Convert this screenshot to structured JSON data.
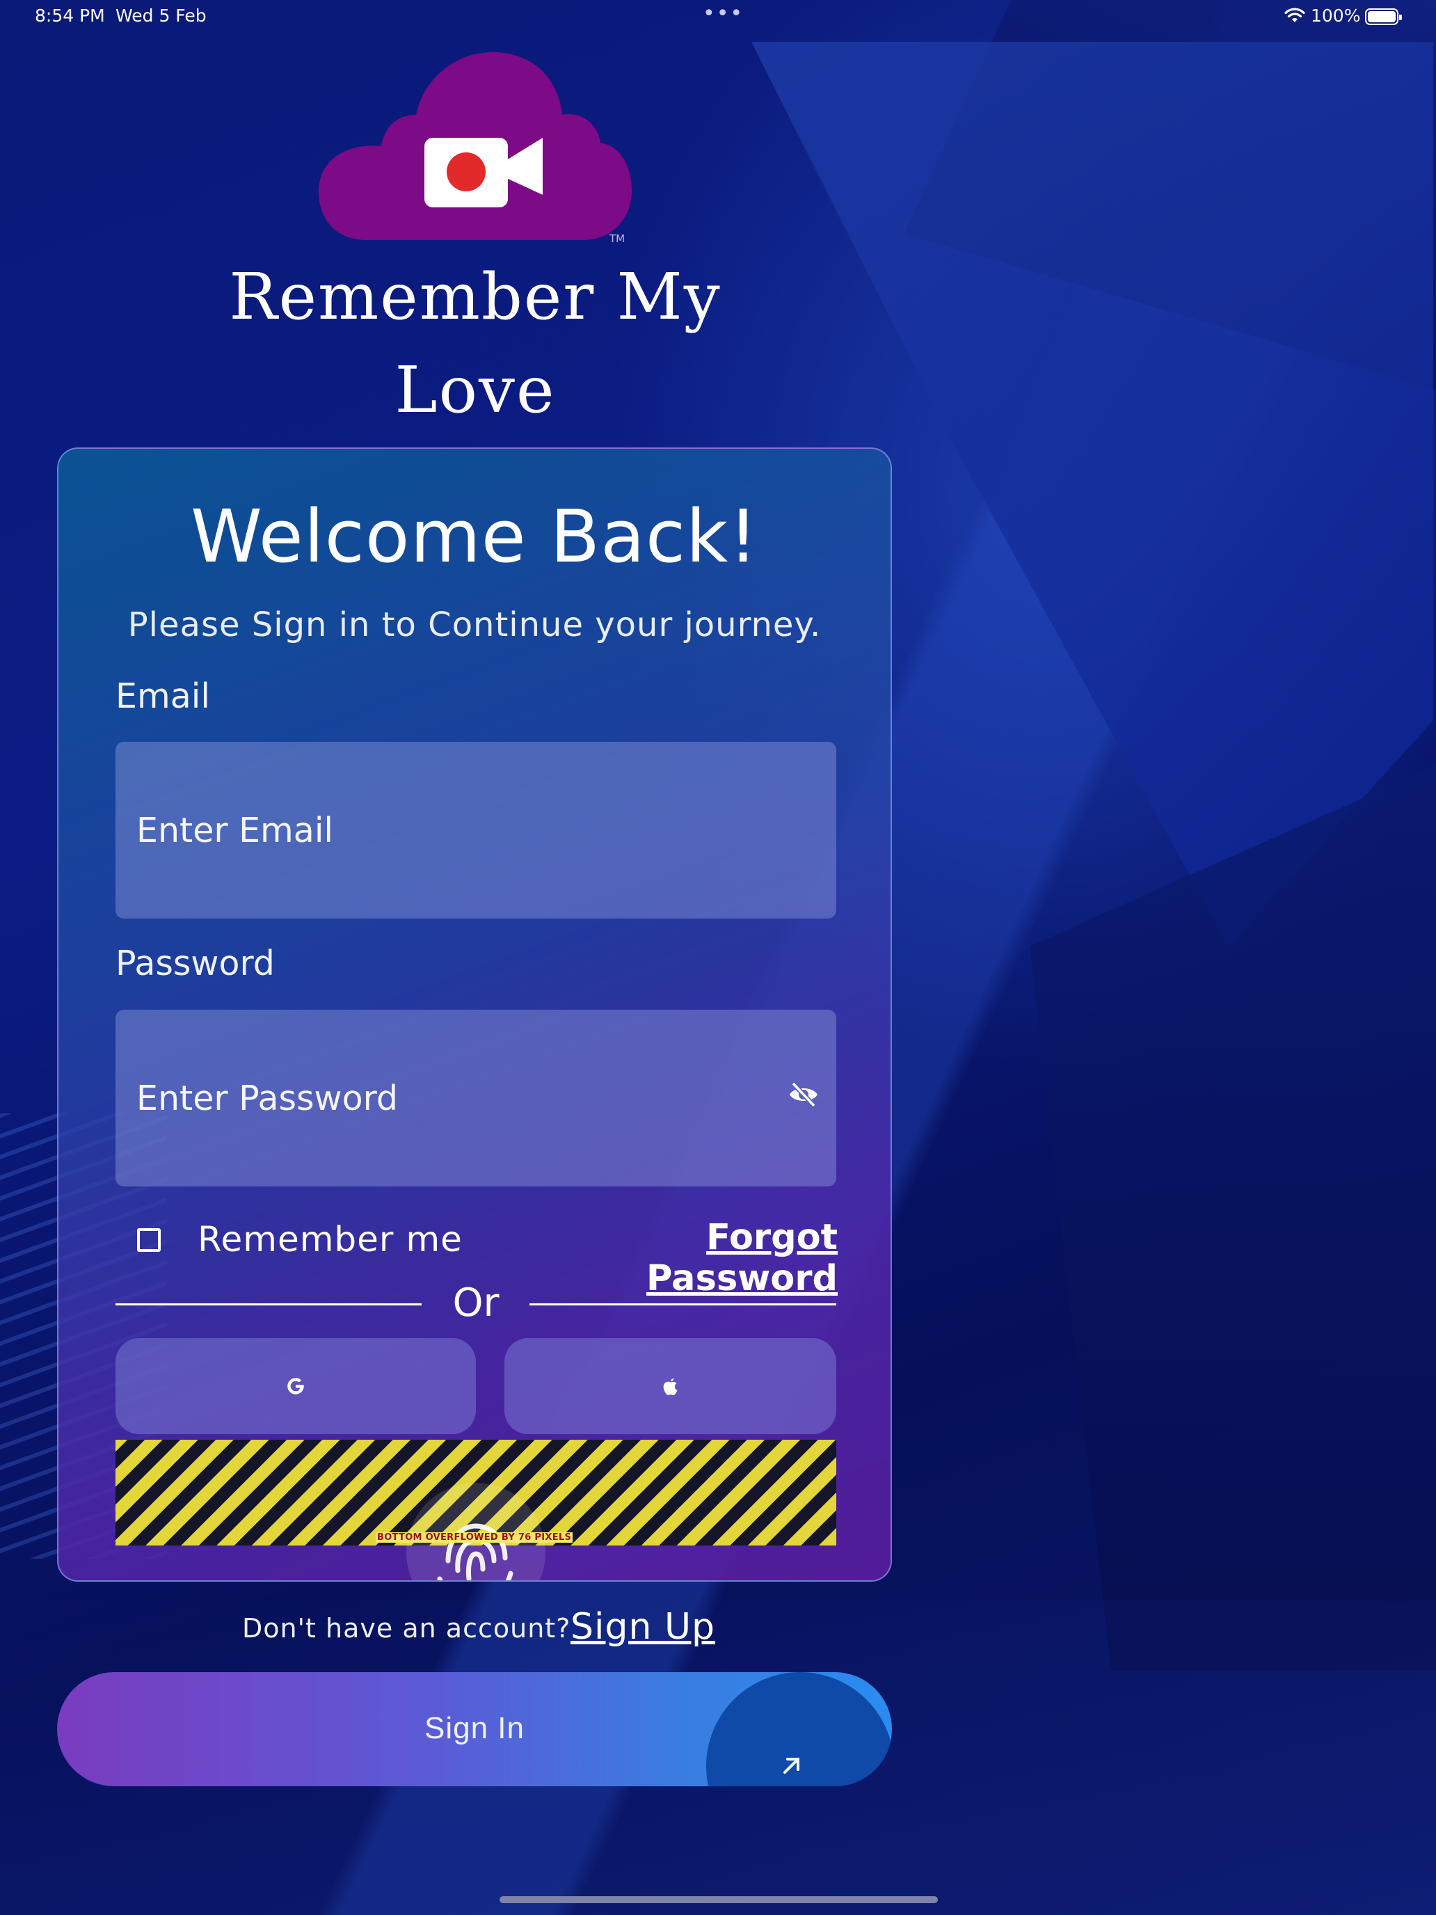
{
  "status_bar": {
    "time": "8:54 PM",
    "date": "Wed 5 Feb",
    "battery": "100%",
    "multitask_dots": "•••"
  },
  "app": {
    "title": "Remember My Love",
    "logo": "cloud-camera-logo",
    "trademark": "TM",
    "colors": {
      "logo_purple": "#7d0a86",
      "record_red": "#e32a2a"
    }
  },
  "card": {
    "welcome": "Welcome Back!",
    "subtitle": "Please Sign in to Continue your journey.",
    "email": {
      "label": "Email",
      "placeholder": "Enter Email",
      "value": ""
    },
    "password": {
      "label": "Password",
      "placeholder": "Enter Password",
      "value": "",
      "toggle_icon": "eye-slash-icon"
    },
    "remember_me": {
      "label": "Remember me",
      "checked": false
    },
    "forgot_password": "Forgot Password",
    "divider_text": "Or",
    "social": [
      {
        "provider": "google",
        "icon": "google-icon",
        "glyph": "G"
      },
      {
        "provider": "apple",
        "icon": "apple-icon"
      }
    ],
    "overflow_warning": "BOTTOM OVERFLOWED BY 76 PIXELS",
    "biometric_icon": "fingerprint-icon"
  },
  "signup_prompt": {
    "text": "Don't have an account?",
    "link": "Sign Up"
  },
  "signin_button": {
    "label": "Sign In",
    "icon": "arrow-up-right-icon",
    "colors": [
      "#7a3cc0",
      "#2a8cf0"
    ]
  }
}
